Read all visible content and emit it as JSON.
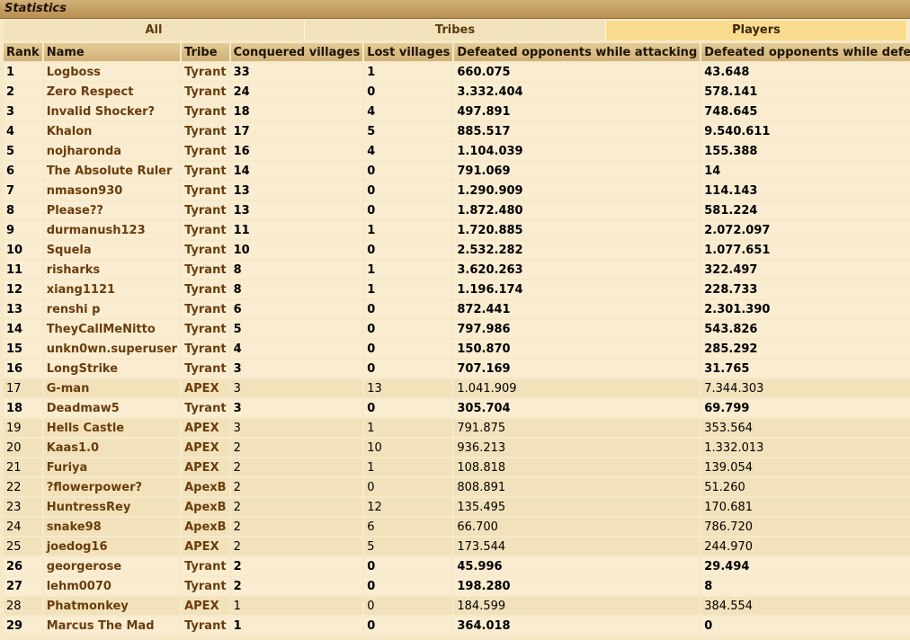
{
  "window": {
    "title": "Statistics"
  },
  "tabs": [
    {
      "label": "All",
      "active": false
    },
    {
      "label": "Tribes",
      "active": false
    },
    {
      "label": "Players",
      "active": true
    }
  ],
  "table": {
    "columns": [
      "Rank",
      "Name",
      "Tribe",
      "Conquered villages",
      "Lost villages",
      "Defeated opponents while attacking",
      "Defeated opponents while defending"
    ],
    "rows": [
      {
        "rank": "1",
        "name": "Logboss",
        "tribe": "Tyrant",
        "conquered": "33",
        "lost": "1",
        "attacking": "660.075",
        "defending": "43.648",
        "ally": true
      },
      {
        "rank": "2",
        "name": "Zero Respect",
        "tribe": "Tyrant",
        "conquered": "24",
        "lost": "0",
        "attacking": "3.332.404",
        "defending": "578.141",
        "ally": true
      },
      {
        "rank": "3",
        "name": "Invalid Shocker?",
        "tribe": "Tyrant",
        "conquered": "18",
        "lost": "4",
        "attacking": "497.891",
        "defending": "748.645",
        "ally": true
      },
      {
        "rank": "4",
        "name": "Khalon",
        "tribe": "Tyrant",
        "conquered": "17",
        "lost": "5",
        "attacking": "885.517",
        "defending": "9.540.611",
        "ally": true
      },
      {
        "rank": "5",
        "name": "nojharonda",
        "tribe": "Tyrant",
        "conquered": "16",
        "lost": "4",
        "attacking": "1.104.039",
        "defending": "155.388",
        "ally": true
      },
      {
        "rank": "6",
        "name": "The Absolute Ruler",
        "tribe": "Tyrant",
        "conquered": "14",
        "lost": "0",
        "attacking": "791.069",
        "defending": "14",
        "ally": true
      },
      {
        "rank": "7",
        "name": "nmason930",
        "tribe": "Tyrant",
        "conquered": "13",
        "lost": "0",
        "attacking": "1.290.909",
        "defending": "114.143",
        "ally": true
      },
      {
        "rank": "8",
        "name": "Please??",
        "tribe": "Tyrant",
        "conquered": "13",
        "lost": "0",
        "attacking": "1.872.480",
        "defending": "581.224",
        "ally": true
      },
      {
        "rank": "9",
        "name": "durmanush123",
        "tribe": "Tyrant",
        "conquered": "11",
        "lost": "1",
        "attacking": "1.720.885",
        "defending": "2.072.097",
        "ally": true
      },
      {
        "rank": "10",
        "name": "Squela",
        "tribe": "Tyrant",
        "conquered": "10",
        "lost": "0",
        "attacking": "2.532.282",
        "defending": "1.077.651",
        "ally": true
      },
      {
        "rank": "11",
        "name": "risharks",
        "tribe": "Tyrant",
        "conquered": "8",
        "lost": "1",
        "attacking": "3.620.263",
        "defending": "322.497",
        "ally": true
      },
      {
        "rank": "12",
        "name": "xiang1121",
        "tribe": "Tyrant",
        "conquered": "8",
        "lost": "1",
        "attacking": "1.196.174",
        "defending": "228.733",
        "ally": true
      },
      {
        "rank": "13",
        "name": "renshi p",
        "tribe": "Tyrant",
        "conquered": "6",
        "lost": "0",
        "attacking": "872.441",
        "defending": "2.301.390",
        "ally": true
      },
      {
        "rank": "14",
        "name": "TheyCallMeNitto",
        "tribe": "Tyrant",
        "conquered": "5",
        "lost": "0",
        "attacking": "797.986",
        "defending": "543.826",
        "ally": true
      },
      {
        "rank": "15",
        "name": "unkn0wn.superuser",
        "tribe": "Tyrant",
        "conquered": "4",
        "lost": "0",
        "attacking": "150.870",
        "defending": "285.292",
        "ally": true
      },
      {
        "rank": "16",
        "name": "LongStrike",
        "tribe": "Tyrant",
        "conquered": "3",
        "lost": "0",
        "attacking": "707.169",
        "defending": "31.765",
        "ally": true
      },
      {
        "rank": "17",
        "name": "G-man",
        "tribe": "APEX",
        "conquered": "3",
        "lost": "13",
        "attacking": "1.041.909",
        "defending": "7.344.303",
        "ally": false
      },
      {
        "rank": "18",
        "name": "Deadmaw5",
        "tribe": "Tyrant",
        "conquered": "3",
        "lost": "0",
        "attacking": "305.704",
        "defending": "69.799",
        "ally": true
      },
      {
        "rank": "19",
        "name": "Hells Castle",
        "tribe": "APEX",
        "conquered": "3",
        "lost": "1",
        "attacking": "791.875",
        "defending": "353.564",
        "ally": false
      },
      {
        "rank": "20",
        "name": "Kaas1.0",
        "tribe": "APEX",
        "conquered": "2",
        "lost": "10",
        "attacking": "936.213",
        "defending": "1.332.013",
        "ally": false
      },
      {
        "rank": "21",
        "name": "Furiya",
        "tribe": "APEX",
        "conquered": "2",
        "lost": "1",
        "attacking": "108.818",
        "defending": "139.054",
        "ally": false
      },
      {
        "rank": "22",
        "name": "?flowerpower?",
        "tribe": "ApexB",
        "conquered": "2",
        "lost": "0",
        "attacking": "808.891",
        "defending": "51.260",
        "ally": false
      },
      {
        "rank": "23",
        "name": "HuntressRey",
        "tribe": "ApexB",
        "conquered": "2",
        "lost": "12",
        "attacking": "135.495",
        "defending": "170.681",
        "ally": false
      },
      {
        "rank": "24",
        "name": "snake98",
        "tribe": "ApexB",
        "conquered": "2",
        "lost": "6",
        "attacking": "66.700",
        "defending": "786.720",
        "ally": false
      },
      {
        "rank": "25",
        "name": "joedog16",
        "tribe": "APEX",
        "conquered": "2",
        "lost": "5",
        "attacking": "173.544",
        "defending": "244.970",
        "ally": false
      },
      {
        "rank": "26",
        "name": "georgerose",
        "tribe": "Tyrant",
        "conquered": "2",
        "lost": "0",
        "attacking": "45.996",
        "defending": "29.494",
        "ally": true
      },
      {
        "rank": "27",
        "name": "lehm0070",
        "tribe": "Tyrant",
        "conquered": "2",
        "lost": "0",
        "attacking": "198.280",
        "defending": "8",
        "ally": true
      },
      {
        "rank": "28",
        "name": "Phatmonkey",
        "tribe": "APEX",
        "conquered": "1",
        "lost": "0",
        "attacking": "184.599",
        "defending": "384.554",
        "ally": false
      },
      {
        "rank": "29",
        "name": "Marcus The Mad",
        "tribe": "Tyrant",
        "conquered": "1",
        "lost": "0",
        "attacking": "364.018",
        "defending": "0",
        "ally": true
      }
    ]
  }
}
